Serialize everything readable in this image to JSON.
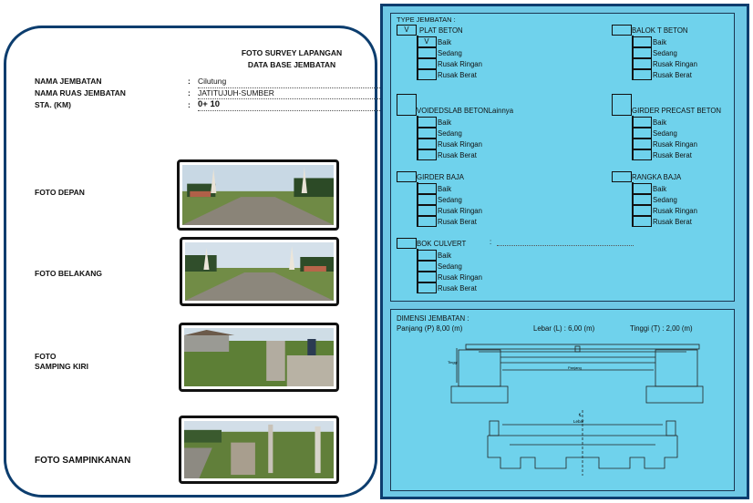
{
  "left": {
    "title_line1": "FOTO SURVEY LAPANGAN",
    "title_line2": "DATA BASE JEMBATAN",
    "fields": [
      {
        "label": "NAMA JEMBATAN",
        "colon": ":",
        "value": "Cilutung"
      },
      {
        "label": "NAMA RUAS JEMBATAN",
        "colon": ":",
        "value": "JATITUJUH-SUMBER"
      },
      {
        "label": "STA. (KM)",
        "colon": ":",
        "value": "0+ 10"
      }
    ],
    "photos": [
      {
        "label_line1": "FOTO DEPAN",
        "label_line2": ""
      },
      {
        "label_line1": "FOTO BELAKANG",
        "label_line2": ""
      },
      {
        "label_line1": "FOTO",
        "label_line2": "SAMPING KIRI"
      },
      {
        "label_line1": "FOTO SAMPINKANAN",
        "label_line2": ""
      }
    ]
  },
  "types": {
    "title": "TYPE JEMBATAN :",
    "conditions": [
      "Baik",
      "Sedang",
      "Rusak Ringan",
      "Rusak Berat"
    ],
    "groups": [
      {
        "name": "PLAT BETON",
        "mark": "V",
        "cond_marks": [
          "V",
          "",
          "",
          ""
        ]
      },
      {
        "name": "BALOK T BETON",
        "mark": "",
        "cond_marks": [
          "",
          "",
          "",
          ""
        ]
      },
      {
        "name": "VOIDEDSLAB BETON",
        "extra": "Lainnya",
        "mark": "",
        "cond_marks": [
          "",
          "",
          "",
          ""
        ]
      },
      {
        "name": "GIRDER PRECAST BETON",
        "mark": "",
        "cond_marks": [
          "",
          "",
          "",
          ""
        ]
      },
      {
        "name": "GIRDER BAJA",
        "mark": "",
        "cond_marks": [
          "",
          "",
          "",
          ""
        ]
      },
      {
        "name": "RANGKA BAJA",
        "mark": "",
        "cond_marks": [
          "",
          "",
          "",
          ""
        ]
      },
      {
        "name": "BOK CULVERT",
        "extra": ":",
        "mark": "",
        "cond_marks": [
          "",
          "",
          "",
          ""
        ]
      }
    ]
  },
  "dimensions": {
    "title": "DIMENSI JEMBATAN :",
    "panjang": "Panjang (P) 8,00 (m)",
    "lebar": "Lebar (L) : 6,00 (m)",
    "tinggi": "Tinggi    (T) : 2,00 (m)",
    "drawing_labels": {
      "tinggi": "Tinggi",
      "panjang": "Panjang",
      "lebar": "Lebar",
      "centerline": "℄"
    }
  }
}
